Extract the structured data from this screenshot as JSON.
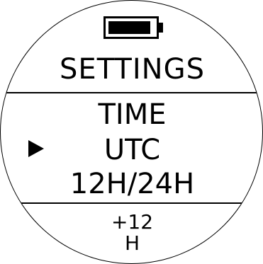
{
  "battery": {
    "icon": "battery-icon",
    "level": 0.92
  },
  "header": {
    "title": "SETTINGS"
  },
  "menu": {
    "items": [
      {
        "label": "TIME",
        "selected": false
      },
      {
        "label": "UTC",
        "selected": true
      },
      {
        "label": "12H/24H",
        "selected": false
      }
    ],
    "selector_icon": "triangle-right-icon"
  },
  "footer": {
    "value": "+12",
    "unit": "H"
  }
}
